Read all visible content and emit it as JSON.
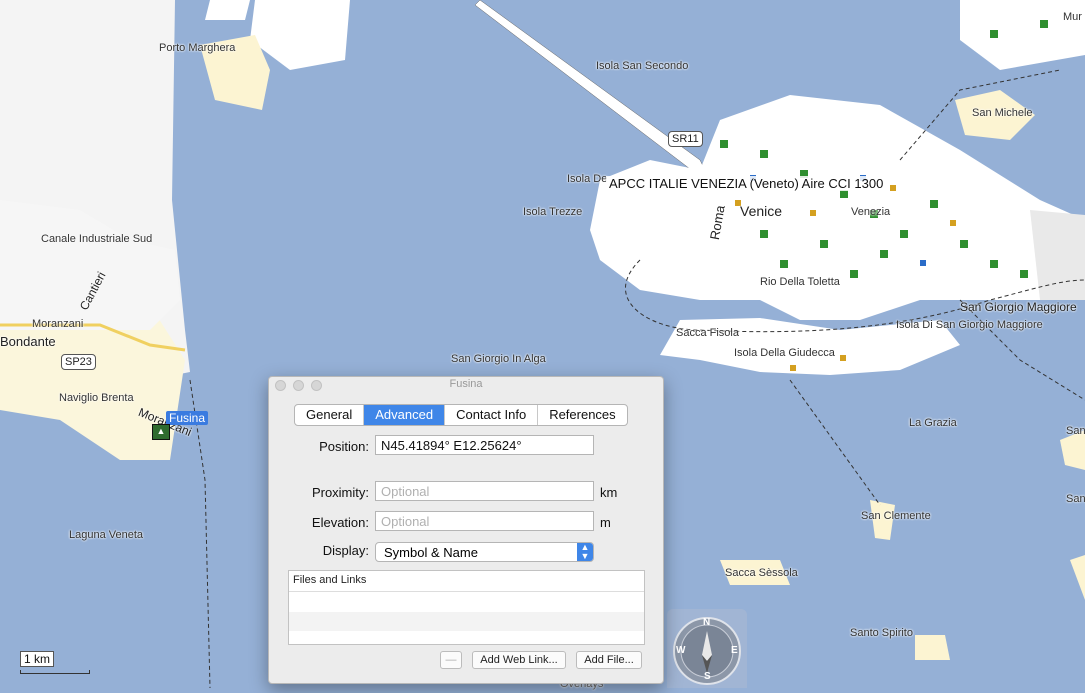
{
  "map": {
    "labels": {
      "porto_marghera": "Porto Marghera",
      "isola_san_secondo": "Isola San Secondo",
      "isola_de": "Isola De",
      "isola_trezze": "Isola Trezze",
      "canale_industriale_sud": "Canale Industriale Sud",
      "cantieri": "Cantieri",
      "moranzani": "Moranzani",
      "bondante": "Bondante",
      "naviglio_brenta": "Naviglio Brenta",
      "morzani": "Moranzani",
      "laguna_veneta": "Laguna Veneta",
      "san_giorgio_in_alga": "San Giorgio In Alga",
      "venice": "Venice",
      "venezia": "Venezia",
      "roma": "Roma",
      "rio_della_toletta": "Rio Della Toletta",
      "sacca_fisola": "Sacca Fisola",
      "isola_della_giudecca": "Isola Della Giudecca",
      "san_michele": "San Michele",
      "san_giorgio_maggiore": "San Giorgio Maggiore",
      "isola_di_san_giorgio_maggiore": "Isola Di San Giorgio Maggiore",
      "la_grazia": "La Grazia",
      "san_clemente": "San Clemente",
      "sacca_sessola": "Sacca Sèssola",
      "santo_spirito": "Santo Spirito",
      "mur": "Mur",
      "san_right1": "San",
      "san_right2": "San",
      "overlays": "Overlays"
    },
    "shields": {
      "sr11": "SR11",
      "sp23": "SP23"
    },
    "poi_tooltip": "APCC ITALIE VENEZIA (Veneto) Aire CCI 1300",
    "selected_waypoint": "Fusina",
    "scale_label": "1 km",
    "compass": {
      "n": "N",
      "e": "E",
      "s": "S",
      "w": "W"
    }
  },
  "dialog": {
    "title": "Fusina",
    "tabs": [
      "General",
      "Advanced",
      "Contact Info",
      "References"
    ],
    "active_tab": "Advanced",
    "position_label": "Position:",
    "position_value": "N45.41894° E12.25624°",
    "proximity_label": "Proximity:",
    "proximity_placeholder": "Optional",
    "proximity_unit": "km",
    "elevation_label": "Elevation:",
    "elevation_placeholder": "Optional",
    "elevation_unit": "m",
    "display_label": "Display:",
    "display_value": "Symbol & Name",
    "files_header": "Files and Links",
    "remove_button": "—",
    "add_web_link_button": "Add Web Link...",
    "add_file_button": "Add File..."
  },
  "colors": {
    "water": "#95b0d6",
    "land": "#ffffff",
    "sand": "#fcf4d2",
    "accent": "#3f86e8"
  }
}
